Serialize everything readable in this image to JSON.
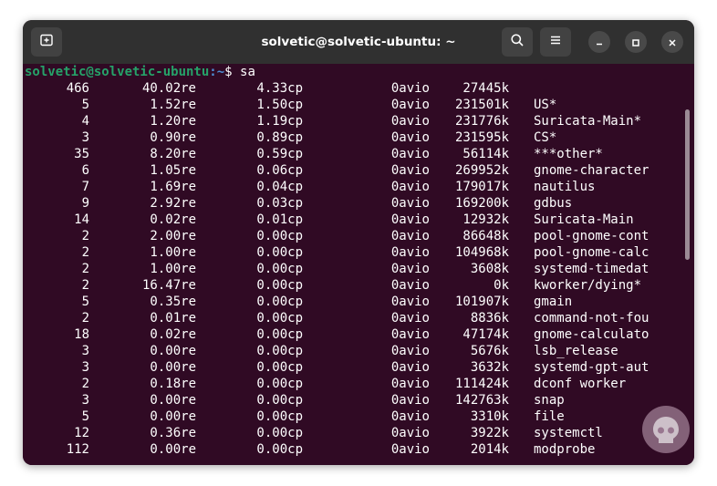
{
  "window": {
    "title": "solvetic@solvetic-ubuntu: ~"
  },
  "prompt": {
    "user": "solvetic@solvetic-ubuntu",
    "path": ":~",
    "symbol": "$",
    "command": " sa"
  },
  "header_row": {
    "count": "466",
    "re": "40.02re",
    "cp": "4.33cp",
    "avio": "0avio",
    "k": "27445k",
    "cmd": ""
  },
  "rows": [
    {
      "count": "5",
      "re": "1.52re",
      "cp": "1.50cp",
      "avio": "0avio",
      "k": "231501k",
      "cmd": "US*"
    },
    {
      "count": "4",
      "re": "1.20re",
      "cp": "1.19cp",
      "avio": "0avio",
      "k": "231776k",
      "cmd": "Suricata-Main*"
    },
    {
      "count": "3",
      "re": "0.90re",
      "cp": "0.89cp",
      "avio": "0avio",
      "k": "231595k",
      "cmd": "CS*"
    },
    {
      "count": "35",
      "re": "8.20re",
      "cp": "0.59cp",
      "avio": "0avio",
      "k": "56114k",
      "cmd": "***other*"
    },
    {
      "count": "6",
      "re": "1.05re",
      "cp": "0.06cp",
      "avio": "0avio",
      "k": "269952k",
      "cmd": "gnome-character"
    },
    {
      "count": "7",
      "re": "1.69re",
      "cp": "0.04cp",
      "avio": "0avio",
      "k": "179017k",
      "cmd": "nautilus"
    },
    {
      "count": "9",
      "re": "2.92re",
      "cp": "0.03cp",
      "avio": "0avio",
      "k": "169200k",
      "cmd": "gdbus"
    },
    {
      "count": "14",
      "re": "0.02re",
      "cp": "0.01cp",
      "avio": "0avio",
      "k": "12932k",
      "cmd": "Suricata-Main"
    },
    {
      "count": "2",
      "re": "2.00re",
      "cp": "0.00cp",
      "avio": "0avio",
      "k": "86648k",
      "cmd": "pool-gnome-cont"
    },
    {
      "count": "2",
      "re": "1.00re",
      "cp": "0.00cp",
      "avio": "0avio",
      "k": "104968k",
      "cmd": "pool-gnome-calc"
    },
    {
      "count": "2",
      "re": "1.00re",
      "cp": "0.00cp",
      "avio": "0avio",
      "k": "3608k",
      "cmd": "systemd-timedat"
    },
    {
      "count": "2",
      "re": "16.47re",
      "cp": "0.00cp",
      "avio": "0avio",
      "k": "0k",
      "cmd": "kworker/dying*"
    },
    {
      "count": "5",
      "re": "0.35re",
      "cp": "0.00cp",
      "avio": "0avio",
      "k": "101907k",
      "cmd": "gmain"
    },
    {
      "count": "2",
      "re": "0.01re",
      "cp": "0.00cp",
      "avio": "0avio",
      "k": "8836k",
      "cmd": "command-not-fou"
    },
    {
      "count": "18",
      "re": "0.02re",
      "cp": "0.00cp",
      "avio": "0avio",
      "k": "47174k",
      "cmd": "gnome-calculato"
    },
    {
      "count": "3",
      "re": "0.00re",
      "cp": "0.00cp",
      "avio": "0avio",
      "k": "5676k",
      "cmd": "lsb_release"
    },
    {
      "count": "3",
      "re": "0.00re",
      "cp": "0.00cp",
      "avio": "0avio",
      "k": "3632k",
      "cmd": "systemd-gpt-aut"
    },
    {
      "count": "2",
      "re": "0.18re",
      "cp": "0.00cp",
      "avio": "0avio",
      "k": "111424k",
      "cmd": "dconf worker"
    },
    {
      "count": "3",
      "re": "0.00re",
      "cp": "0.00cp",
      "avio": "0avio",
      "k": "142763k",
      "cmd": "snap"
    },
    {
      "count": "5",
      "re": "0.00re",
      "cp": "0.00cp",
      "avio": "0avio",
      "k": "3310k",
      "cmd": "file"
    },
    {
      "count": "12",
      "re": "0.36re",
      "cp": "0.00cp",
      "avio": "0avio",
      "k": "3922k",
      "cmd": "systemctl"
    },
    {
      "count": "112",
      "re": "0.00re",
      "cp": "0.00cp",
      "avio": "0avio",
      "k": "2014k",
      "cmd": "modprobe"
    }
  ],
  "icons": {
    "new_tab": "new-tab-icon",
    "search": "search-icon",
    "menu": "hamburger-menu-icon",
    "minimize": "minimize-icon",
    "maximize": "maximize-icon",
    "close": "close-icon",
    "watermark": "solvetic-logo"
  },
  "colors": {
    "terminal_bg": "#300a24",
    "titlebar_bg": "#303030",
    "prompt_user": "#26a269",
    "prompt_path": "#4e8fd6",
    "text": "#ffffff"
  }
}
